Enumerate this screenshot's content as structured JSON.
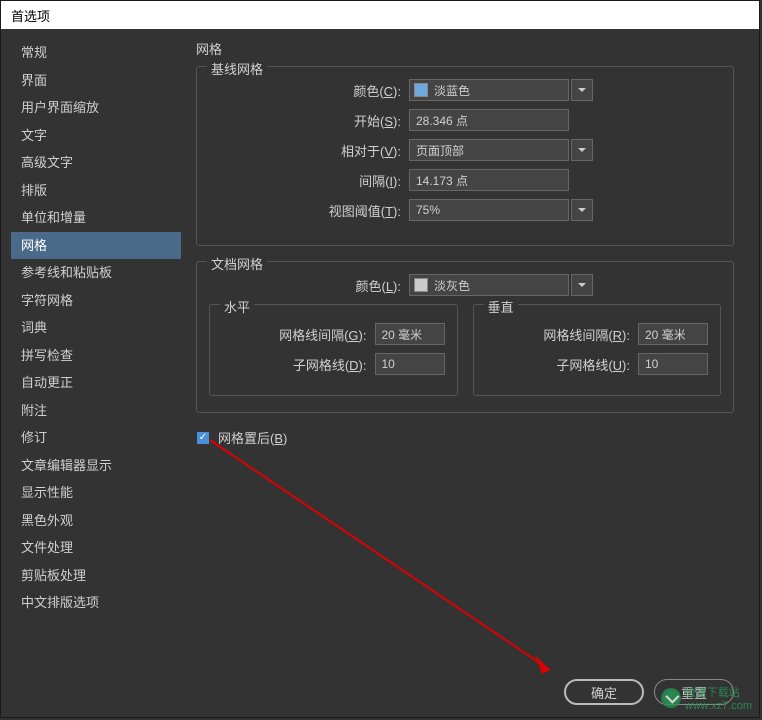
{
  "window": {
    "title": "首选项"
  },
  "sidebar": {
    "items": [
      {
        "label": "常规"
      },
      {
        "label": "界面"
      },
      {
        "label": "用户界面缩放"
      },
      {
        "label": "文字"
      },
      {
        "label": "高级文字"
      },
      {
        "label": "排版"
      },
      {
        "label": "单位和增量"
      },
      {
        "label": "网格"
      },
      {
        "label": "参考线和粘贴板"
      },
      {
        "label": "字符网格"
      },
      {
        "label": "词典"
      },
      {
        "label": "拼写检查"
      },
      {
        "label": "自动更正"
      },
      {
        "label": "附注"
      },
      {
        "label": "修订"
      },
      {
        "label": "文章编辑器显示"
      },
      {
        "label": "显示性能"
      },
      {
        "label": "黑色外观"
      },
      {
        "label": "文件处理"
      },
      {
        "label": "剪贴板处理"
      },
      {
        "label": "中文排版选项"
      }
    ],
    "selected_index": 7
  },
  "main": {
    "heading": "网格",
    "baseline_grid": {
      "legend": "基线网格",
      "color_label": "颜色(C):",
      "color_value": "淡蓝色",
      "color_swatch": "#6fa8dc",
      "start_label": "开始(S):",
      "start_value": "28.346 点",
      "relative_label": "相对于(V):",
      "relative_value": "页面顶部",
      "spacing_label": "间隔(I):",
      "spacing_value": "14.173 点",
      "threshold_label": "视图阈值(T):",
      "threshold_value": "75%"
    },
    "document_grid": {
      "legend": "文档网格",
      "color_label": "颜色(L):",
      "color_value": "淡灰色",
      "color_swatch": "#cccccc",
      "horizontal": {
        "legend": "水平",
        "gridline_label": "网格线间隔(G):",
        "gridline_value": "20 毫米",
        "sub_label": "子网格线(D):",
        "sub_value": "10"
      },
      "vertical": {
        "legend": "垂直",
        "gridline_label": "网格线间隔(R):",
        "gridline_value": "20 毫米",
        "sub_label": "子网格线(U):",
        "sub_value": "10"
      }
    },
    "grid_behind": {
      "label": "网格置后(B)",
      "checked": true
    }
  },
  "buttons": {
    "ok": "确定",
    "reset": "重置"
  },
  "watermark": {
    "brand": "极速下载站",
    "url": "www.xz7.com"
  }
}
